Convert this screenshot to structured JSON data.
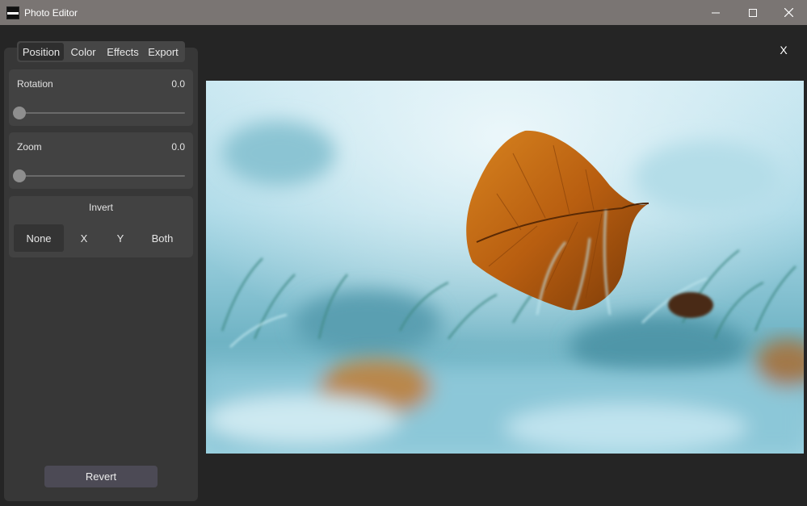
{
  "window": {
    "title": "Photo Editor",
    "controls": {
      "minimize": "minimize-icon",
      "maximize": "maximize-icon",
      "close": "close-icon"
    }
  },
  "tabs": [
    {
      "label": "Position",
      "active": true
    },
    {
      "label": "Color",
      "active": false
    },
    {
      "label": "Effects",
      "active": false
    },
    {
      "label": "Export",
      "active": false
    }
  ],
  "position": {
    "rotation": {
      "label": "Rotation",
      "value": "0.0",
      "fraction": 0
    },
    "zoom": {
      "label": "Zoom",
      "value": "0.0",
      "fraction": 0
    },
    "invert": {
      "title": "Invert",
      "options": [
        "None",
        "X",
        "Y",
        "Both"
      ],
      "selected": "None"
    }
  },
  "revert_label": "Revert",
  "close_label": "X",
  "photo": {
    "subject": "autumn leaf on frosted grass",
    "icon": "image"
  },
  "colors": {
    "titlebar": "#7a7573",
    "background": "#252525",
    "panel": "#373737",
    "card": "#424242",
    "revert": "#4c4a55"
  }
}
